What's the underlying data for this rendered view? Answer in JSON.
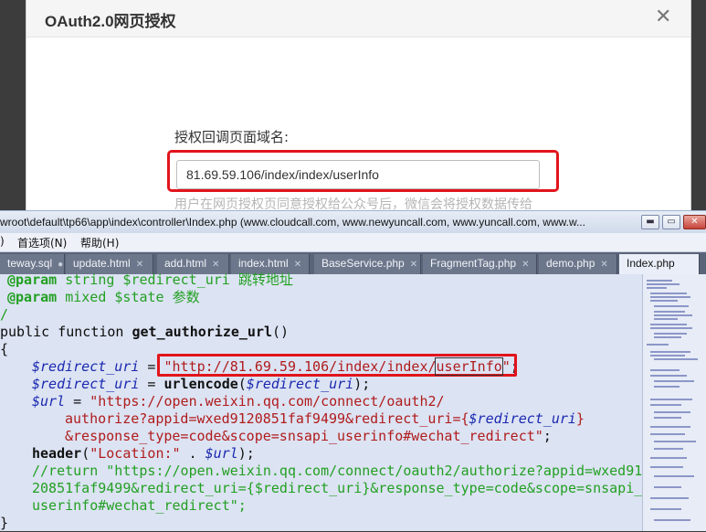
{
  "dialog": {
    "title": "OAuth2.0网页授权",
    "close_glyph": "✕",
    "field_label": "授权回调页面域名:",
    "field_value": "81.69.59.106/index/index/userInfo",
    "field_hint": "用户在网页授权页同意授权给公众号后，微信会将授权数据传给"
  },
  "editor": {
    "title": "wroot\\default\\tp66\\app\\index\\controller\\Index.php (www.cloudcall.com, www.newyuncall.com, www.yuncall.com, www.w...",
    "menu": [
      {
        "label": ")"
      },
      {
        "label": "首选项(N)"
      },
      {
        "label": "帮助(H)"
      }
    ],
    "window_buttons": {
      "minimize": "▬",
      "maximize": "▭",
      "close": "✕"
    },
    "tabs": [
      {
        "label": "teway.sql",
        "marker": "●"
      },
      {
        "label": "update.html",
        "marker": "✕"
      },
      {
        "label": "add.html",
        "marker": "✕"
      },
      {
        "label": "index.html",
        "marker": "✕"
      },
      {
        "label": "BaseService.php",
        "marker": "✕"
      },
      {
        "label": "FragmentTag.php",
        "marker": "✕"
      },
      {
        "label": "demo.php",
        "marker": "✕"
      },
      {
        "label": "Index.php",
        "marker": ""
      }
    ],
    "code": {
      "l1_doc": "@param",
      "l1_rest": " string $redirect_uri 跳转地址",
      "l2_doc": "@param",
      "l2_rest": " mixed $state 参数",
      "l3": "/",
      "l4_kw": "public function ",
      "l4_fn": "get_authorize_url",
      "l4_rest": "()",
      "l5": "{",
      "l6_var": "$redirect_uri",
      "l6_op": " = ",
      "l6_str1": "\"http://81.69.59.106/index/index/",
      "l6_str2": "userInfo",
      "l6_str3": "\"",
      "l6_end": ";",
      "l7_var": "$redirect_uri",
      "l7_op": " = ",
      "l7_fn": "urlencode",
      "l7_open": "(",
      "l7_var2": "$redirect_uri",
      "l7_end": ");",
      "l8_var": "$url",
      "l8_op": " = ",
      "l8_str": "\"https://open.weixin.qq.com/connect/oauth2/",
      "l9_str": "authorize?appid=wxed9120851faf9499&redirect_uri={",
      "l9_var": "$redirect_uri",
      "l9_str2": "}",
      "l10_str": "&response_type=code&scope=snsapi_userinfo#wechat_redirect\"",
      "l10_end": ";",
      "l11_fn": "header",
      "l11_open": "(",
      "l11_str": "\"Location:\"",
      "l11_op": " . ",
      "l11_var": "$url",
      "l11_end": ");",
      "l12": "//return \"https://open.weixin.qq.com/connect/oauth2/authorize?appid=wxed91",
      "l13": "20851faf9499&redirect_uri={$redirect_uri}&response_type=code&scope=snsapi_",
      "l14": "userinfo#wechat_redirect\";",
      "l15": "}"
    }
  }
}
